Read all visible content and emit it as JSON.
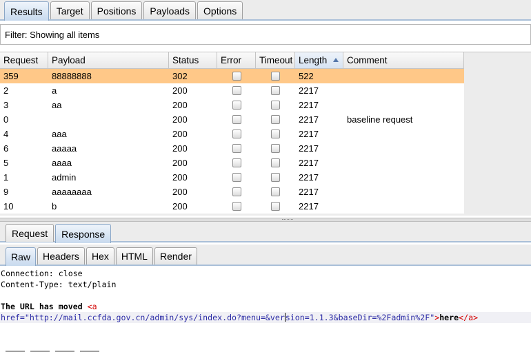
{
  "top_tabs": [
    "Results",
    "Target",
    "Positions",
    "Payloads",
    "Options"
  ],
  "filter": {
    "text": "Filter: Showing all items"
  },
  "table": {
    "columns": [
      "Request",
      "Payload",
      "Status",
      "Error",
      "Timeout",
      "Length",
      "Comment"
    ],
    "sorted_column": "Length",
    "rows": [
      [
        "359",
        "88888888",
        "302",
        "",
        "",
        "522",
        ""
      ],
      [
        "2",
        "a",
        "200",
        "",
        "",
        "2217",
        ""
      ],
      [
        "3",
        "aa",
        "200",
        "",
        "",
        "2217",
        ""
      ],
      [
        "0",
        "",
        "200",
        "",
        "",
        "2217",
        "baseline request"
      ],
      [
        "4",
        "aaa",
        "200",
        "",
        "",
        "2217",
        ""
      ],
      [
        "6",
        "aaaaa",
        "200",
        "",
        "",
        "2217",
        ""
      ],
      [
        "5",
        "aaaa",
        "200",
        "",
        "",
        "2217",
        ""
      ],
      [
        "1",
        "admin",
        "200",
        "",
        "",
        "2217",
        ""
      ],
      [
        "9",
        "aaaaaaaa",
        "200",
        "",
        "",
        "2217",
        ""
      ],
      [
        "10",
        "b",
        "200",
        "",
        "",
        "2217",
        ""
      ]
    ]
  },
  "mid_tabs": [
    "Request",
    "Response"
  ],
  "low_tabs": [
    "Raw",
    "Headers",
    "Hex",
    "HTML",
    "Render"
  ],
  "raw": {
    "line1": "Connection: close",
    "line2": "Content-Type: text/plain",
    "moved_text": "The URL has moved ",
    "open_tag": "<a",
    "href_attr": "href=",
    "href_value_a": "\"http://mail.ccfda.gov.cn/admin/sys/index.do?menu=&ver",
    "href_value_b": "sion=1.1.3&baseDir=%2Fadmin%2F\"",
    "tag_close": ">",
    "link_text": "here",
    "end_tag": "</a>"
  },
  "colors": {
    "selected_row": "#ffc888",
    "tab_active": "#c8daee",
    "tag": "#d40000",
    "attr": "#2a2aa5"
  }
}
